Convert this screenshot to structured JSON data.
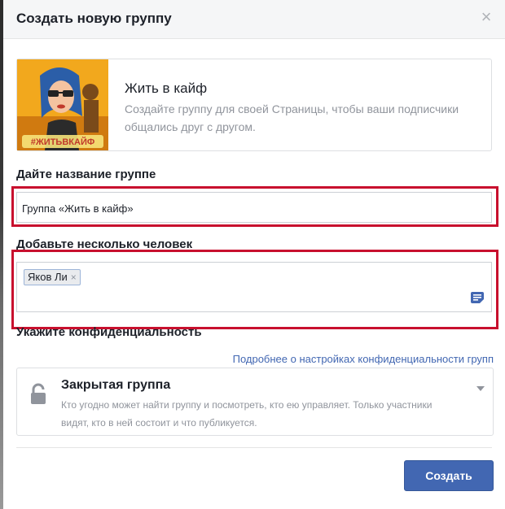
{
  "dialog": {
    "title": "Создать новую группу",
    "close_symbol": "×"
  },
  "page_card": {
    "name": "Жить в кайф",
    "description": "Создайте группу для своей Страницы, чтобы ваши подписчики общались друг с другом.",
    "avatar_hashtag": "#ЖИТЬВКАЙФ"
  },
  "group_name": {
    "label": "Дайте название группе",
    "value": "Группа «Жить в кайф»"
  },
  "members": {
    "label": "Добавьте несколько человек",
    "chips": [
      {
        "name": "Яков Ли",
        "remove_symbol": "×"
      }
    ]
  },
  "privacy": {
    "label": "Укажите конфиденциальность",
    "link_text": "Подробнее о настройках конфиденциальности групп",
    "selected_title": "Закрытая группа",
    "selected_description": "Кто угодно может найти группу и посмотреть, кто ею управляет. Только участники видят, кто в ней состоит и что публикуется."
  },
  "footer": {
    "create_label": "Создать"
  },
  "colors": {
    "accent": "#4267b2",
    "highlight_frame": "#c8102e",
    "avatar_bg": "#f2a81d"
  },
  "icons": [
    "close-icon",
    "remove-chip-icon",
    "note-icon",
    "lock-icon",
    "caret-down-icon"
  ]
}
